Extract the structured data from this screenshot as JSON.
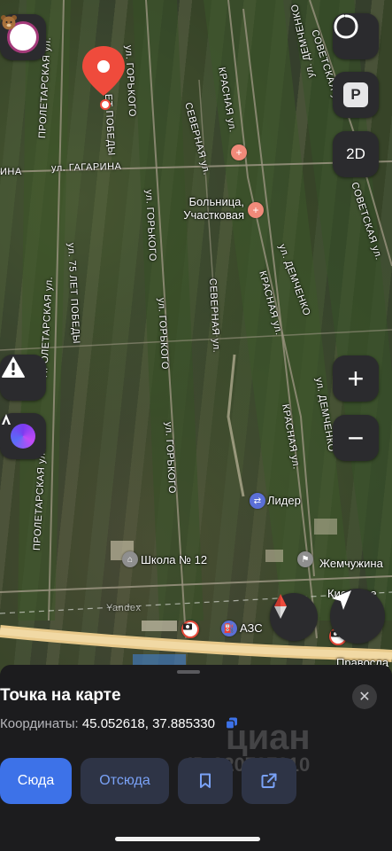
{
  "map": {
    "streets": {
      "proletarskaya_1": "ПРОЛЕТАРСКАЯ ул.",
      "proletarskaya_2": "ПРОЛЕТАРСКАЯ ул.",
      "proletarskaya_3": "ПРОЛЕТАРСКАЯ ул.",
      "gorkogo_1": "ул. ГОРЬКОГО",
      "gorkogo_2": "ул. ГОРЬКОГО",
      "gorkogo_3": "ул. ГОРЬКОГО",
      "gorkogo_4": "ул. ГОРЬКОГО",
      "let_pobedy_1": "ЕТ ПОБЕДЫ",
      "let_pobedy_2": "ул. 75 ЛЕТ ПОБЕДЫ",
      "gagarina_1": "ИНА",
      "gagarina_2": "ул. ГАГАРИНА",
      "krasnaya_1": "КРАСНАЯ ул.",
      "krasnaya_2": "КРАСНАЯ ул.",
      "krasnaya_3": "КРАСНАЯ ул.",
      "demchenko_1": "ул. ДЕМЧЕНКО",
      "demchenko_2": "ул. ДЕМЧЕНКО",
      "demchenko_3": "ул. ДЕМЧЕНКО",
      "severnaya_1": "СЕВЕРНАЯ ул.",
      "severnaya_2": "СЕВЕРНАЯ ул.",
      "sovetskaya_1": "СОВЕТСКАЯ ул.",
      "sovetskaya_2": "СОВЕТСКАЯ ул.",
      "yandex": "Yandex"
    },
    "pois": {
      "hospital": "Больница, Участковая",
      "hospital_line1": "Больница,",
      "hospital_line2": "Участковая",
      "lider": "Лидер",
      "school": "Школа № 12",
      "zhemchuzhina": "Жемчужина",
      "kievskoe": "Киевское",
      "azs": "АЗС",
      "pravoslav": "Правосла"
    }
  },
  "controls": {
    "avatar_icon": "bear-avatar-icon",
    "alice_icon": "alice-ring-icon",
    "parking": "P",
    "view_mode": "2D",
    "zoom_in": "+",
    "zoom_out": "−"
  },
  "sheet": {
    "title": "Точка на карте",
    "coords_label": "Координаты:",
    "coords_value": "45.052618, 37.885330",
    "btn_here": "Сюда",
    "btn_from": "Отсюда",
    "close": "✕"
  },
  "watermark": {
    "brand": "циан",
    "id": "ID 320737310"
  },
  "colors": {
    "accent_blue": "#3d72e8",
    "secondary_btn_bg": "#2e3446",
    "secondary_btn_text": "#7aa2f7",
    "pin_red": "#ef4b3c",
    "sheet_bg": "#1c1c1e"
  }
}
